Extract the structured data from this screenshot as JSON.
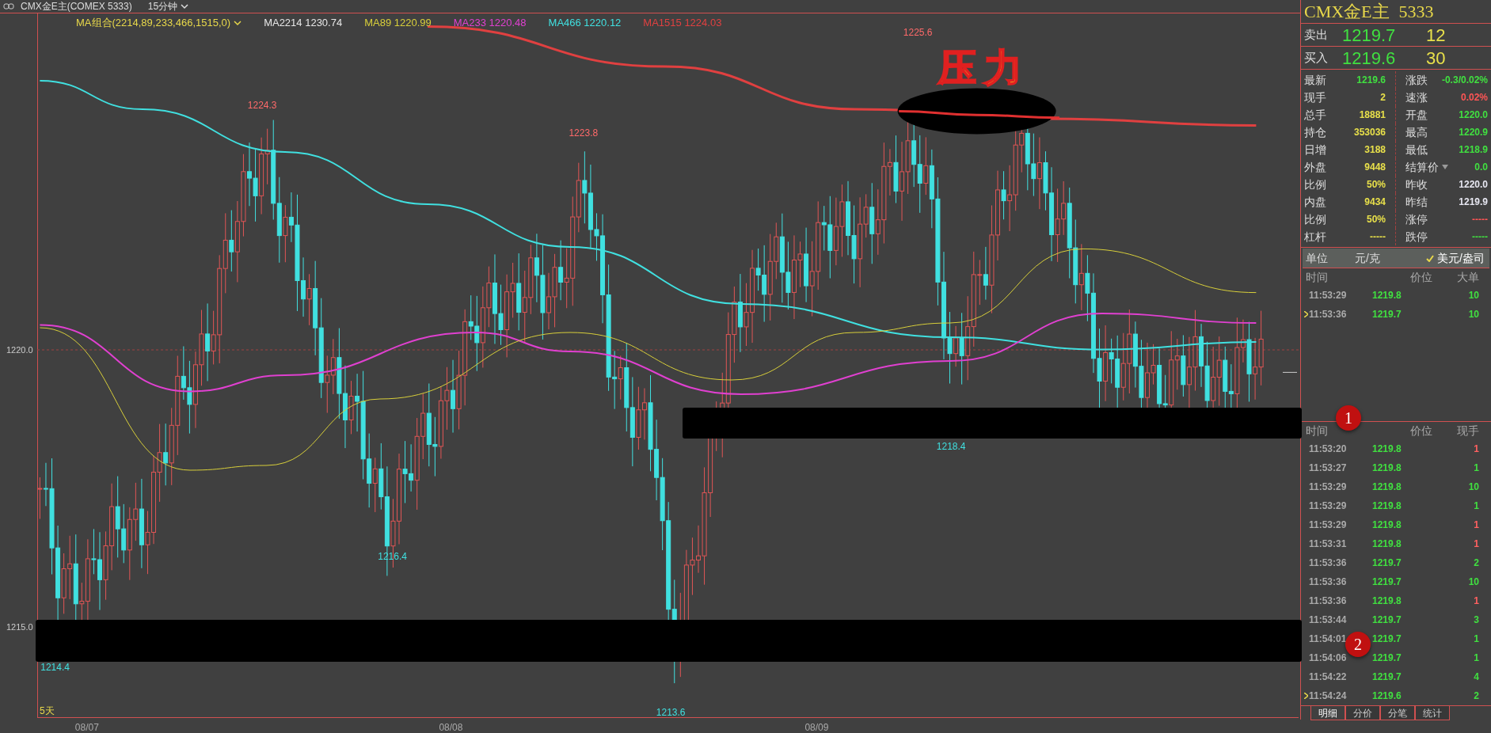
{
  "header": {
    "symbol": "CMX金E主(COMEX 5333)",
    "period": "15分钟"
  },
  "ma_legend": [
    {
      "text": "MA组合(2214,89,233,466,1515,0)",
      "color": "#e8d84a",
      "menu": true
    },
    {
      "text": "MA2214 1230.74",
      "color": "#e6e6e6",
      "menu": false
    },
    {
      "text": "MA89 1220.99",
      "color": "#d8cf3a",
      "menu": false
    },
    {
      "text": "MA233 1220.48",
      "color": "#e040d0",
      "menu": false
    },
    {
      "text": "MA466 1220.12",
      "color": "#40e0e0",
      "menu": false
    },
    {
      "text": "MA1515 1224.03",
      "color": "#e04040",
      "menu": false
    }
  ],
  "chart": {
    "y_labels": [
      "1220.0",
      "1215.0"
    ],
    "price_labels": [
      {
        "text": "1225.6",
        "kind": "high"
      },
      {
        "text": "1224.3",
        "kind": "high"
      },
      {
        "text": "1223.8",
        "kind": "high"
      },
      {
        "text": "1216.4",
        "kind": "low"
      },
      {
        "text": "1218.4",
        "kind": "low"
      },
      {
        "text": "1214.4",
        "kind": "low"
      },
      {
        "text": "1213.6",
        "kind": "low"
      }
    ],
    "range_label": "5天",
    "dates": [
      "08/07",
      "08/08",
      "08/09"
    ],
    "annotation": "压力",
    "markers": [
      "1",
      "2"
    ]
  },
  "quote": {
    "title": "CMX金E主",
    "code": "5333",
    "ask": {
      "label": "卖出",
      "price": "1219.7",
      "volume": "12"
    },
    "bid": {
      "label": "买入",
      "price": "1219.6",
      "volume": "30"
    },
    "stats": [
      {
        "label": "最新",
        "value": "1219.6",
        "color": "#40e040",
        "menu": false
      },
      {
        "label": "涨跌",
        "value": "-0.3/0.02%",
        "color": "#40e040",
        "menu": false
      },
      {
        "label": "现手",
        "value": "2",
        "color": "#e8e04a",
        "menu": false
      },
      {
        "label": "速涨",
        "value": "0.02%",
        "color": "#ff5555",
        "menu": false
      },
      {
        "label": "总手",
        "value": "18881",
        "color": "#e8e04a",
        "menu": false
      },
      {
        "label": "开盘",
        "value": "1220.0",
        "color": "#40e040",
        "menu": false
      },
      {
        "label": "持仓",
        "value": "353036",
        "color": "#e8e04a",
        "menu": false
      },
      {
        "label": "最高",
        "value": "1220.9",
        "color": "#40e040",
        "menu": false
      },
      {
        "label": "日增",
        "value": "3188",
        "color": "#e8e04a",
        "menu": false
      },
      {
        "label": "最低",
        "value": "1218.9",
        "color": "#40e040",
        "menu": false
      },
      {
        "label": "外盘",
        "value": "9448",
        "color": "#e8e04a",
        "menu": false
      },
      {
        "label": "结算价",
        "value": "0.0",
        "color": "#40e040",
        "menu": true
      },
      {
        "label": "比例",
        "value": "50%",
        "color": "#e8e04a",
        "menu": false
      },
      {
        "label": "昨收",
        "value": "1220.0",
        "color": "#e6e6f0",
        "menu": false
      },
      {
        "label": "内盘",
        "value": "9434",
        "color": "#e8e04a",
        "menu": false
      },
      {
        "label": "昨结",
        "value": "1219.9",
        "color": "#e6e6f0",
        "menu": false
      },
      {
        "label": "比例",
        "value": "50%",
        "color": "#e8e04a",
        "menu": false
      },
      {
        "label": "涨停",
        "value": "-----",
        "color": "#ff5555",
        "menu": false
      },
      {
        "label": "杠杆",
        "value": "-----",
        "color": "#e8e04a",
        "menu": false
      },
      {
        "label": "跌停",
        "value": "-----",
        "color": "#40e040",
        "menu": false
      }
    ],
    "unit": {
      "label": "单位",
      "options": [
        {
          "text": "元/克",
          "selected": false
        },
        {
          "text": "美元/盎司",
          "selected": true
        }
      ]
    }
  },
  "big_orders": {
    "columns": [
      "时间",
      "价位",
      "大单"
    ],
    "rows": [
      {
        "time": "11:53:29",
        "price": "1219.8",
        "volume": "10",
        "current": false
      },
      {
        "time": "11:53:36",
        "price": "1219.7",
        "volume": "10",
        "current": true
      }
    ]
  },
  "ticks": {
    "columns": [
      "时间",
      "价位",
      "现手"
    ],
    "rows": [
      {
        "time": "11:53:20",
        "price": "1219.8",
        "volume": "1",
        "color": "#ff6060",
        "current": false
      },
      {
        "time": "11:53:27",
        "price": "1219.8",
        "volume": "1",
        "color": "#40e040",
        "current": false
      },
      {
        "time": "11:53:29",
        "price": "1219.8",
        "volume": "10",
        "color": "#40e040",
        "current": false
      },
      {
        "time": "11:53:29",
        "price": "1219.8",
        "volume": "1",
        "color": "#40e040",
        "current": false
      },
      {
        "time": "11:53:29",
        "price": "1219.8",
        "volume": "1",
        "color": "#ff6060",
        "current": false
      },
      {
        "time": "11:53:31",
        "price": "1219.8",
        "volume": "1",
        "color": "#ff6060",
        "current": false
      },
      {
        "time": "11:53:36",
        "price": "1219.7",
        "volume": "2",
        "color": "#40e040",
        "current": false
      },
      {
        "time": "11:53:36",
        "price": "1219.7",
        "volume": "10",
        "color": "#40e040",
        "current": false
      },
      {
        "time": "11:53:36",
        "price": "1219.8",
        "volume": "1",
        "color": "#ff6060",
        "current": false
      },
      {
        "time": "11:53:44",
        "price": "1219.7",
        "volume": "3",
        "color": "#40e040",
        "current": false
      },
      {
        "time": "11:54:01",
        "price": "1219.7",
        "volume": "1",
        "color": "#40e040",
        "current": false
      },
      {
        "time": "11:54:06",
        "price": "1219.7",
        "volume": "1",
        "color": "#40e040",
        "current": false
      },
      {
        "time": "11:54:22",
        "price": "1219.7",
        "volume": "4",
        "color": "#40e040",
        "current": false
      },
      {
        "time": "11:54:24",
        "price": "1219.6",
        "volume": "2",
        "color": "#40e040",
        "current": true
      }
    ]
  },
  "tabs": [
    {
      "label": "明细",
      "selected": true
    },
    {
      "label": "分价",
      "selected": false
    },
    {
      "label": "分笔",
      "selected": false
    },
    {
      "label": "统计",
      "selected": false
    }
  ]
}
